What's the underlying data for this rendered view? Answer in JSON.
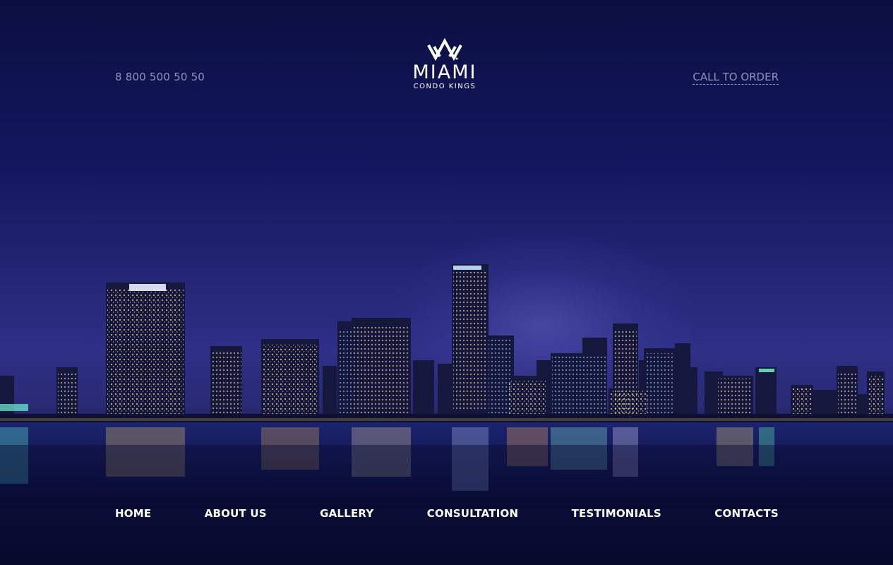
{
  "header": {
    "phone": "8 800 500 50 50",
    "cta_label": "CALL TO ORDER"
  },
  "logo": {
    "main_text": "MIAMI",
    "sub_text": "CONDO KINGS",
    "icon": "crown-icon"
  },
  "hero": {
    "image": "miami-skyline-night-photo"
  },
  "nav": {
    "items": [
      {
        "label": "HOME"
      },
      {
        "label": "ABOUT US"
      },
      {
        "label": "GALLERY"
      },
      {
        "label": "CONSULTATION"
      },
      {
        "label": "TESTIMONIALS"
      },
      {
        "label": "CONTACTS"
      }
    ]
  },
  "colors": {
    "background": "#0b0f3d",
    "muted_text": "#8f93b8",
    "nav_text": "#ffffff"
  }
}
